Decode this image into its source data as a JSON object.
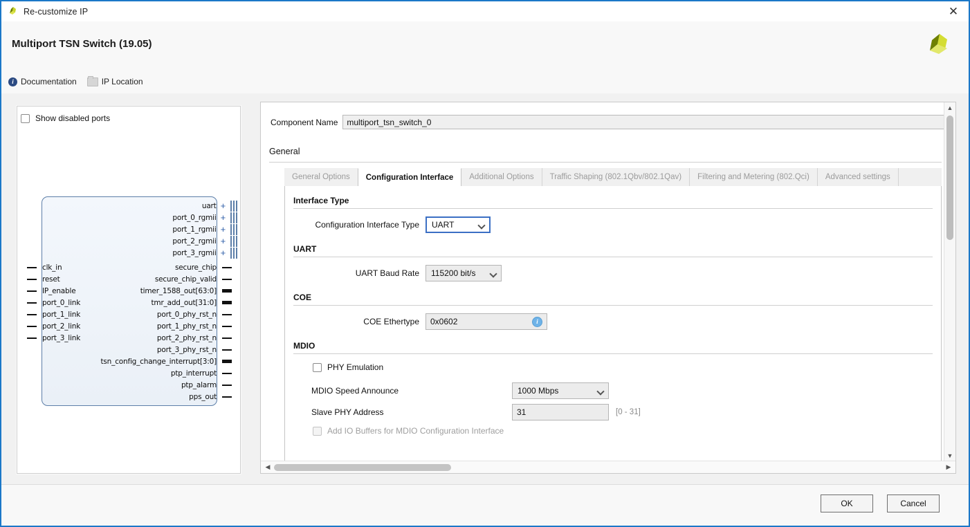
{
  "window": {
    "title": "Re-customize IP",
    "close_label": "✕",
    "app_icon": "xilinx-logo-icon"
  },
  "header": {
    "ip_title": "Multiport TSN Switch (19.05)",
    "links": [
      {
        "label": "Documentation",
        "icon": "info-icon"
      },
      {
        "label": "IP Location",
        "icon": "folder-icon"
      }
    ],
    "brand_logo": "xilinx-logo"
  },
  "left_panel": {
    "show_disabled_ports": {
      "label": "Show disabled ports",
      "checked": false
    },
    "bus_interfaces": [
      {
        "name": "uart"
      },
      {
        "name": "port_0_rgmii"
      },
      {
        "name": "port_1_rgmii"
      },
      {
        "name": "port_2_rgmii"
      },
      {
        "name": "port_3_rgmii"
      }
    ],
    "input_ports": [
      {
        "name": "clk_in"
      },
      {
        "name": "reset"
      },
      {
        "name": "IP_enable"
      },
      {
        "name": "port_0_link"
      },
      {
        "name": "port_1_link"
      },
      {
        "name": "port_2_link"
      },
      {
        "name": "port_3_link"
      }
    ],
    "output_ports": [
      {
        "name": "secure_chip",
        "bus": false
      },
      {
        "name": "secure_chip_valid",
        "bus": false
      },
      {
        "name": "timer_1588_out[63:0]",
        "bus": true
      },
      {
        "name": "tmr_add_out[31:0]",
        "bus": true
      },
      {
        "name": "port_0_phy_rst_n",
        "bus": false
      },
      {
        "name": "port_1_phy_rst_n",
        "bus": false
      },
      {
        "name": "port_2_phy_rst_n",
        "bus": false
      },
      {
        "name": "port_3_phy_rst_n",
        "bus": false
      },
      {
        "name": "tsn_config_change_interrupt[3:0]",
        "bus": true
      },
      {
        "name": "ptp_interrupt",
        "bus": false
      },
      {
        "name": "ptp_alarm",
        "bus": false
      },
      {
        "name": "pps_out",
        "bus": false
      }
    ]
  },
  "right_panel": {
    "component_name": {
      "label": "Component Name",
      "value": "multiport_tsn_switch_0"
    },
    "general_label": "General",
    "tabs": [
      {
        "label": "General Options",
        "active": false
      },
      {
        "label": "Configuration Interface",
        "active": true
      },
      {
        "label": "Additional Options",
        "active": false
      },
      {
        "label": "Traffic Shaping (802.1Qbv/802.1Qav)",
        "active": false
      },
      {
        "label": "Filtering and Metering (802.Qci)",
        "active": false
      },
      {
        "label": "Advanced settings",
        "active": false
      }
    ],
    "sections": {
      "interface_type": {
        "heading": "Interface Type",
        "config_interface_type": {
          "label": "Configuration Interface Type",
          "value": "UART"
        }
      },
      "uart": {
        "heading": "UART",
        "baud_rate": {
          "label": "UART Baud Rate",
          "value": "115200 bit/s"
        }
      },
      "coe": {
        "heading": "COE",
        "ethertype": {
          "label": "COE Ethertype",
          "value": "0x0602",
          "info_icon": "info-icon"
        }
      },
      "mdio": {
        "heading": "MDIO",
        "phy_emulation": {
          "label": "PHY Emulation",
          "checked": false
        },
        "speed_announce": {
          "label": "MDIO Speed Announce",
          "value": "1000 Mbps"
        },
        "slave_phy_address": {
          "label": "Slave PHY Address",
          "value": "31",
          "hint": "[0 - 31]"
        },
        "add_io_buffers": {
          "label": "Add IO Buffers for MDIO Configuration Interface",
          "checked": false,
          "disabled": true
        }
      }
    }
  },
  "footer": {
    "ok_label": "OK",
    "cancel_label": "Cancel"
  },
  "colors": {
    "window_border": "#1b78c8",
    "accent_focus": "#3b6fc4",
    "block_border": "#5c7ea8",
    "brand_green": "#c8d42a",
    "brand_dark_green": "#6e8000"
  }
}
